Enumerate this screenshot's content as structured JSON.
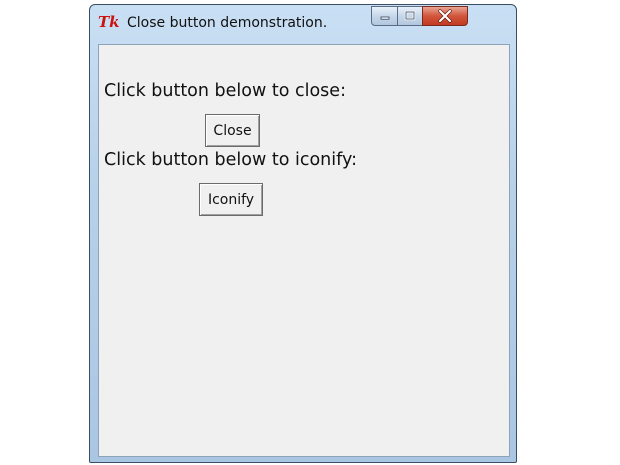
{
  "window": {
    "title": "Close button demonstration.",
    "app_icon": "Tk"
  },
  "titlebar_controls": {
    "minimize": "minimize-icon",
    "maximize": "maximize-icon",
    "close": "close-icon"
  },
  "content": {
    "close_prompt": "Click button below to close:",
    "close_button": "Close",
    "iconify_prompt": "Click button below to iconify:",
    "iconify_button": "Iconify"
  },
  "colors": {
    "client_background": "#f0f0f0",
    "close_button_red": "#c23b22",
    "tk_icon": "#cc1111"
  }
}
